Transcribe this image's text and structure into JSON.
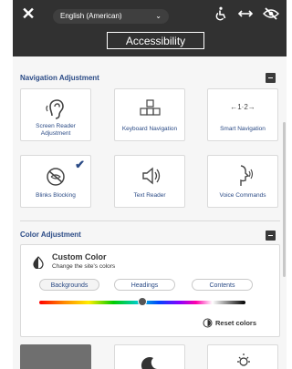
{
  "header": {
    "language": "English (American)",
    "title": "Accessibility"
  },
  "sections": {
    "navigation": {
      "title": "Navigation Adjustment",
      "cards": [
        {
          "label": "Screen Reader Adjustment",
          "icon": "ear-icon"
        },
        {
          "label": "Keyboard Navigation",
          "icon": "keyboard-icon"
        },
        {
          "label": "Smart Navigation",
          "icon": "smart-navigation-icon",
          "glyph": "←1·2→"
        },
        {
          "label": "Blinks Blocking",
          "icon": "blink-block-icon",
          "checked": true
        },
        {
          "label": "Text Reader",
          "icon": "speaker-icon"
        },
        {
          "label": "Voice Commands",
          "icon": "voice-commands-icon"
        }
      ]
    },
    "color": {
      "title": "Color Adjustment",
      "custom_title": "Custom Color",
      "custom_subtitle": "Change the site's colors",
      "tabs": [
        "Backgrounds",
        "Headings",
        "Contents"
      ],
      "active_tab": "Backgrounds",
      "slider_value": 0.5,
      "reset_label": "Reset colors"
    }
  },
  "colors": {
    "header_bg": "#313131",
    "accent": "#2b4b86",
    "panel_bg": "#f6f6f6"
  }
}
